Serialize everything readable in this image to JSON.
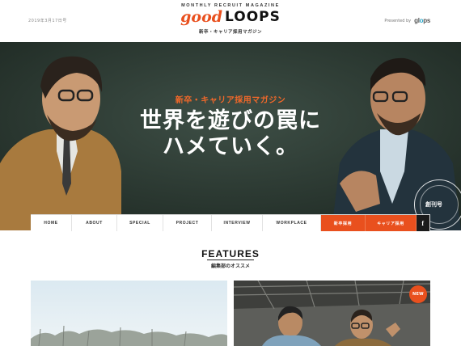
{
  "header": {
    "date": "2019年3月17日号",
    "magazine_tag": "MONTHLY RECRUIT MAGAZINE",
    "logo_good": "good",
    "logo_loops": "LOOPS",
    "logo_sub": "新卒・キャリア採用マガジン",
    "presented_by": "Presented by",
    "brand_prefix": "gl",
    "brand_suffix": "ps"
  },
  "hero": {
    "subtitle": "新卒・キャリア採用マガジン",
    "title_line1": "世界を遊びの罠に",
    "title_line2": "ハメていく。",
    "seal_label": "創刊号"
  },
  "nav": {
    "items": [
      "HOME",
      "ABOUT",
      "SPECIAL",
      "PROJECT",
      "INTERVIEW",
      "WORKPLACE"
    ],
    "new_grad": "新卒採用",
    "career": "キャリア採用",
    "facebook": "f"
  },
  "features": {
    "title": "FEATURES",
    "subtitle": "編集部のオススメ",
    "new_badge": "NEW"
  },
  "colors": {
    "accent": "#e9501e",
    "hero_bg": "#2e3b34",
    "sub_text": "#f0682a"
  }
}
